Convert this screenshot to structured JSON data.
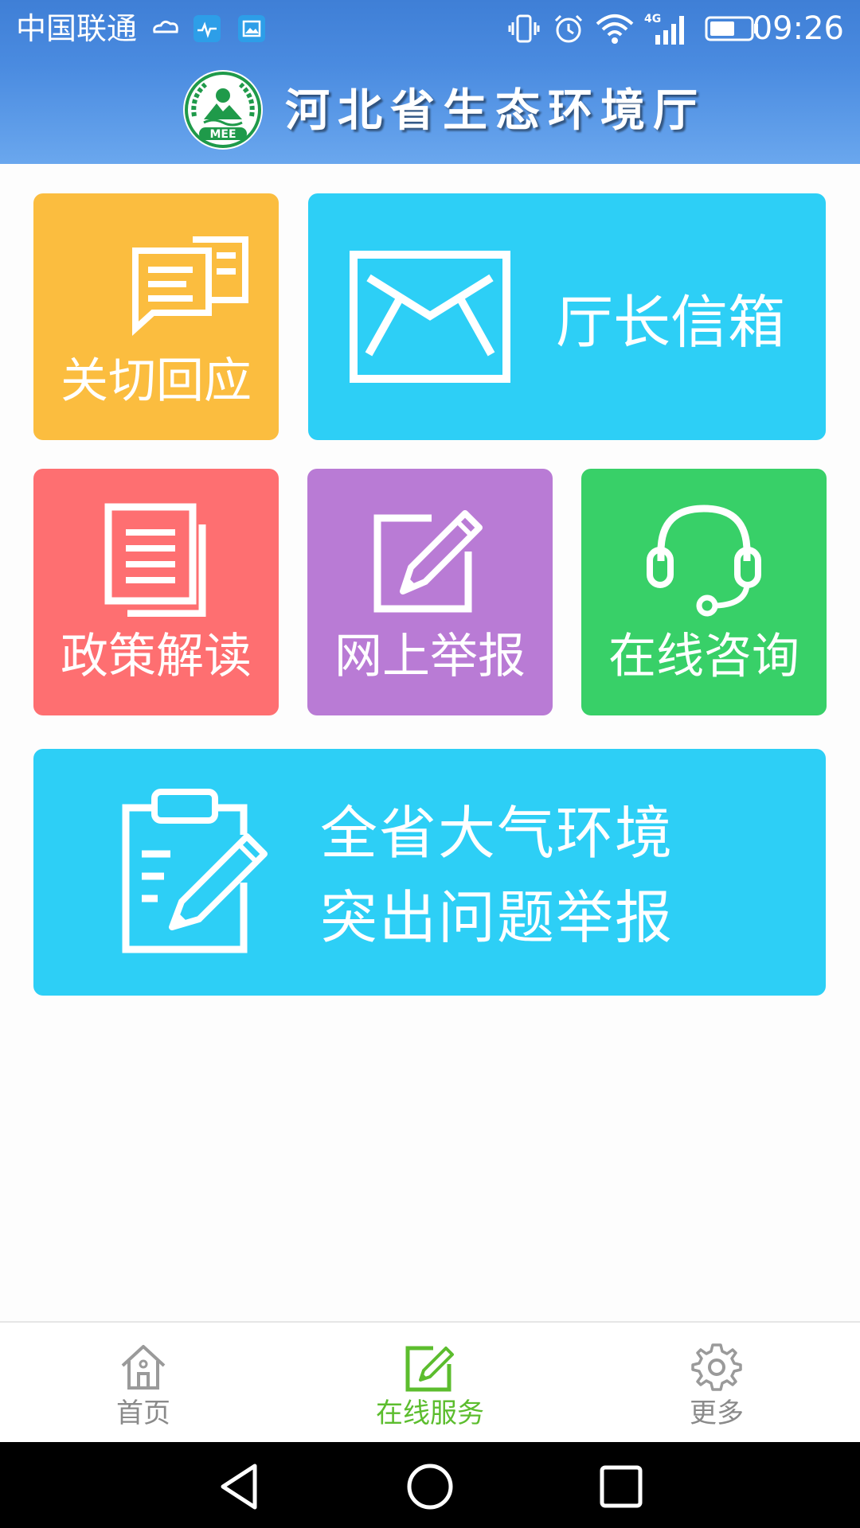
{
  "status_bar": {
    "carrier": "中国联通",
    "network": "4G",
    "time": "09:26"
  },
  "header": {
    "title": "河北省生态环境厅",
    "logo_text": "MEE"
  },
  "tiles": {
    "concern": {
      "label": "关切回应",
      "icon": "speech-bubble-icon"
    },
    "mailbox": {
      "label": "厅长信箱",
      "icon": "envelope-icon"
    },
    "policy": {
      "label": "政策解读",
      "icon": "document-icon"
    },
    "report": {
      "label": "网上举报",
      "icon": "pencil-edit-icon"
    },
    "consult": {
      "label": "在线咨询",
      "icon": "headset-icon"
    },
    "air": {
      "line1": "全省大气环境",
      "line2": "突出问题举报",
      "icon": "clipboard-pen-icon"
    }
  },
  "nav": {
    "home": "首页",
    "services": "在线服务",
    "more": "更多",
    "active": "services",
    "active_color": "#5cbd2e"
  },
  "colors": {
    "yellow": "#fbbd3f",
    "blue": "#2dcff6",
    "red": "#fe6f71",
    "purple": "#b97bd5",
    "green": "#38d068"
  }
}
